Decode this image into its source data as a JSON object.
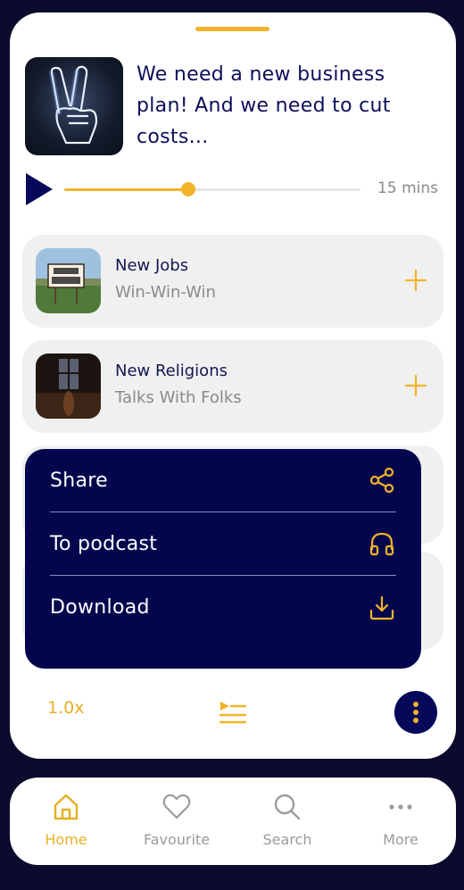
{
  "episode": {
    "title": "We need a new business plan! And we need to cut costs...",
    "duration": "15 mins",
    "progress": 0.42
  },
  "queue": [
    {
      "title": "New Jobs",
      "subtitle": "Win-Win-Win",
      "thumb_icon": "now-hiring-sign"
    },
    {
      "title": "New Religions",
      "subtitle": "Talks With Folks",
      "thumb_icon": "church-interior"
    }
  ],
  "context_menu": {
    "items": [
      {
        "label": "Share",
        "icon": "share-icon"
      },
      {
        "label": "To podcast",
        "icon": "headphones-icon"
      },
      {
        "label": "Download",
        "icon": "download-icon"
      }
    ]
  },
  "player_controls": {
    "speed": "1.0x"
  },
  "tabbar": {
    "tabs": [
      {
        "label": "Home",
        "icon": "home-icon",
        "active": true
      },
      {
        "label": "Favourite",
        "icon": "heart-icon",
        "active": false
      },
      {
        "label": "Search",
        "icon": "search-icon",
        "active": false
      },
      {
        "label": "More",
        "icon": "more-horizontal-icon",
        "active": false
      }
    ]
  },
  "colors": {
    "accent": "#f2b428",
    "navy": "#04064d",
    "background": "#0b0b2e"
  }
}
